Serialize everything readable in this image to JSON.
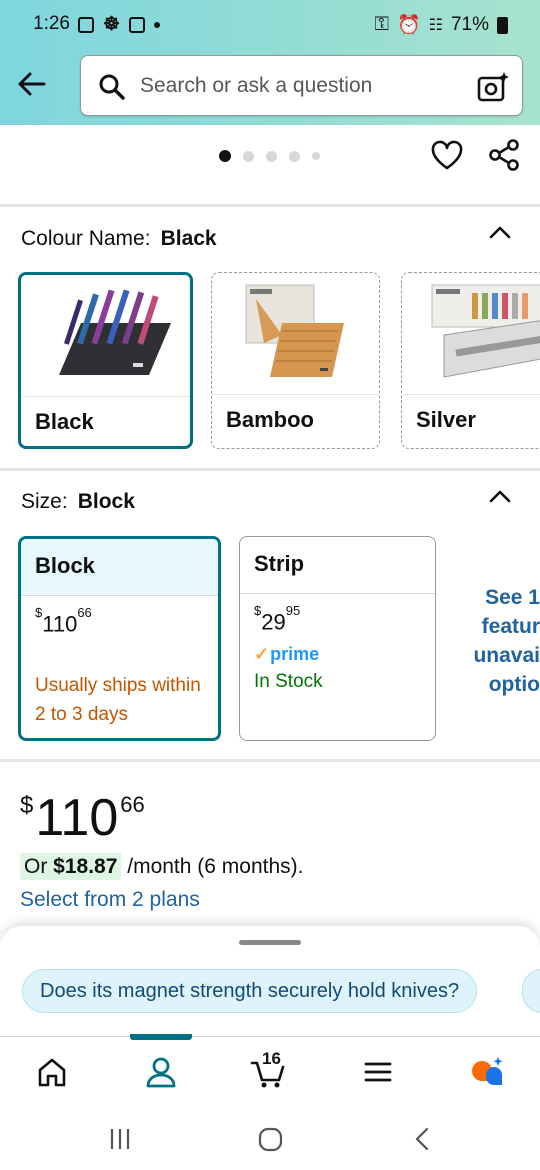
{
  "status_bar": {
    "time": "1:26",
    "battery": "71%"
  },
  "search": {
    "placeholder": "Search or ask a question"
  },
  "colour": {
    "label": "Colour Name:",
    "selected": "Black",
    "options": [
      {
        "label": "Black"
      },
      {
        "label": "Bamboo"
      },
      {
        "label": "Silver"
      }
    ]
  },
  "size": {
    "label": "Size:",
    "selected": "Block",
    "options": [
      {
        "label": "Block",
        "price_whole": "110",
        "price_cents": "66",
        "currency": "$",
        "availability": "Usually ships within 2 to 3 days"
      },
      {
        "label": "Strip",
        "price_whole": "29",
        "price_cents": "95",
        "currency": "$",
        "prime": "prime",
        "availability": "In Stock"
      }
    ],
    "see_more": "See 1 featur unavai optio"
  },
  "price": {
    "currency": "$",
    "whole": "110",
    "cents": "66",
    "monthly_prefix": "Or",
    "monthly_amount": "$18.87",
    "monthly_suffix": "/month (6 months).",
    "plans_link": "Select from 2 plans"
  },
  "questions": [
    "Does its magnet strength securely hold knives?"
  ],
  "bottom_nav": {
    "items": [
      "home-icon",
      "account-icon",
      "cart-icon",
      "menu-icon",
      "rufus-icon"
    ],
    "active": "account-icon",
    "cart_count": "16"
  },
  "colors": {
    "accent": "#007185",
    "link": "#2162a1",
    "ship": "#c45500",
    "in_stock": "#007600"
  }
}
